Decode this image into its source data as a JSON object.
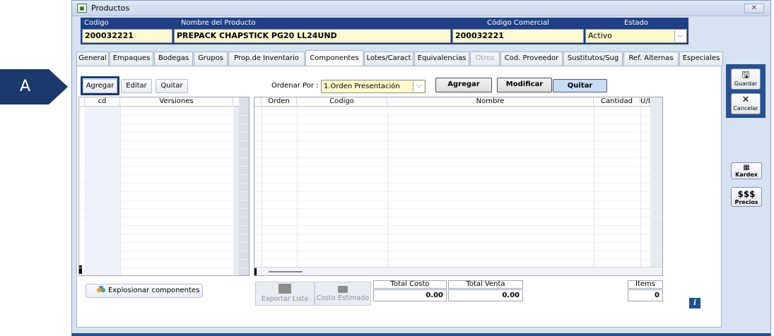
{
  "callout": {
    "label": "A"
  },
  "window": {
    "title": "Productos",
    "close_glyph": "✕"
  },
  "header": {
    "codigo_label": "Codigo",
    "codigo_value": "200032221",
    "nombre_label": "Nombre del Producto",
    "nombre_value": "PREPACK CHAPSTICK PG20 LL24UND",
    "comercial_label": "Código Comercial",
    "comercial_value": "200032221",
    "estado_label": "Estado",
    "estado_value": "Activo"
  },
  "tabs": [
    {
      "label": "General"
    },
    {
      "label": "Empaques"
    },
    {
      "label": "Bodegas"
    },
    {
      "label": "Grupos"
    },
    {
      "label": "Prop.de Inventario"
    },
    {
      "label": "Componentes"
    },
    {
      "label": "Lotes/Caract"
    },
    {
      "label": "Equivalencias"
    },
    {
      "label": "Otros"
    },
    {
      "label": "Cod. Proveedor"
    },
    {
      "label": "Sustitutos/Sug"
    },
    {
      "label": "Ref. Alternas"
    },
    {
      "label": "Especiales"
    }
  ],
  "versions": {
    "agregar": "Agregar",
    "editar": "Editar",
    "quitar": "Quitar",
    "col_cd": "cd",
    "col_versiones": "Versiones"
  },
  "components": {
    "ordenar_label": "Ordenar Por :",
    "ordenar_value": "1.Orden Presentación",
    "agregar": "Agregar",
    "modificar": "Modificar",
    "quitar": "Quitar",
    "col_orden": "Orden",
    "col_codigo": "Codigo",
    "col_nombre": "Nombre",
    "col_cantidad": "Cantidad",
    "col_um": "U/I"
  },
  "footer": {
    "explosionar": "Explosionar componentes",
    "exportar": "Exportar Lista",
    "costo_estimado": "Costo Estimado",
    "total_costo_label": "Total Costo",
    "total_costo_value": "0.00",
    "total_venta_label": "Total Venta",
    "total_venta_value": "0.00",
    "items_label": "Items",
    "items_value": "0"
  },
  "sidebar": {
    "guardar": "Guardar",
    "cancelar": "Cancelar",
    "kardex": "Kardex",
    "precios_glyph": "$$$",
    "precios": "Precios"
  },
  "colors": {
    "header_bg": "#1f3f86",
    "callout_bg": "#1b3a6b",
    "value_bg": "#fdfbd4"
  }
}
